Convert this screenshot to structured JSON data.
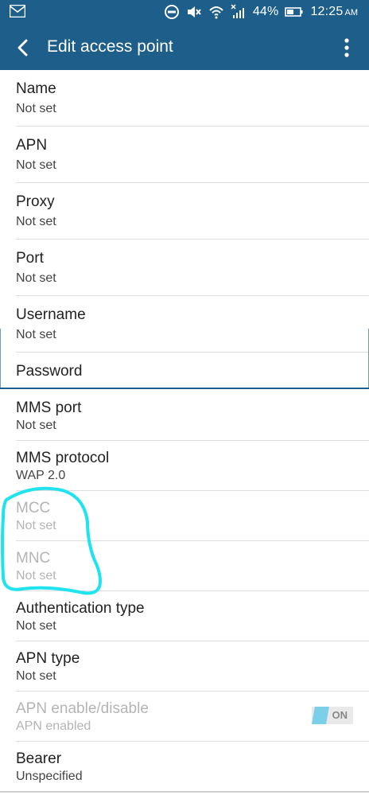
{
  "status_bar": {
    "battery_percent": "44%",
    "time": "12:25",
    "ampm": "AM"
  },
  "app_bar": {
    "title": "Edit access point"
  },
  "fields": [
    {
      "title": "Name",
      "value": "Not set",
      "enabled": true
    },
    {
      "title": "APN",
      "value": "Not set",
      "enabled": true
    },
    {
      "title": "Proxy",
      "value": "Not set",
      "enabled": true
    },
    {
      "title": "Port",
      "value": "Not set",
      "enabled": true
    },
    {
      "title": "Username",
      "value": "Not set",
      "enabled": true
    },
    {
      "title": "Password",
      "value": "",
      "enabled": true
    },
    {
      "title": "MMS port",
      "value": "Not set",
      "enabled": true
    },
    {
      "title": "MMS protocol",
      "value": "WAP 2.0",
      "enabled": true
    },
    {
      "title": "MCC",
      "value": "Not set",
      "enabled": false
    },
    {
      "title": "MNC",
      "value": "Not set",
      "enabled": false
    },
    {
      "title": "Authentication type",
      "value": "Not set",
      "enabled": true
    },
    {
      "title": "APN type",
      "value": "Not set",
      "enabled": true
    },
    {
      "title": "APN enable/disable",
      "value": "APN enabled",
      "enabled": false,
      "toggle_label": "ON"
    },
    {
      "title": "Bearer",
      "value": "Unspecified",
      "enabled": true
    }
  ],
  "colors": {
    "app_bar": "#1d5f8a",
    "annotation": "#1fe3ef",
    "toggle_accent": "#7ccfe9"
  },
  "icons": [
    "mail-icon",
    "dnd-icon",
    "mute-icon",
    "wifi-icon",
    "no-signal-icon",
    "battery-icon",
    "back-arrow-icon",
    "overflow-menu-icon"
  ]
}
